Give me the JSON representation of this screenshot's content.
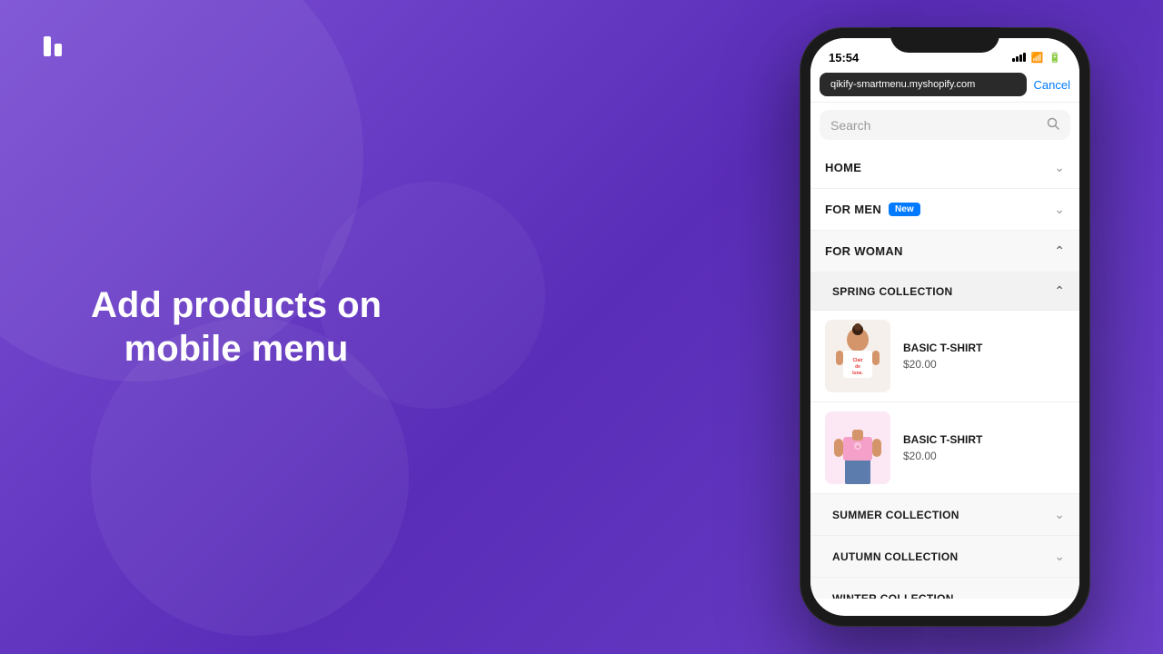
{
  "background": {
    "color": "#6b3fc7"
  },
  "logo": {
    "alt": "Qikify logo"
  },
  "hero": {
    "line1": "Add products on",
    "line2": "mobile menu"
  },
  "phone": {
    "status_bar": {
      "time": "15:54",
      "arrow": "▶"
    },
    "browser": {
      "url": "qikify-smartmenu.myshopify.com",
      "cancel_label": "Cancel"
    },
    "search": {
      "placeholder": "Search"
    },
    "menu_items": [
      {
        "label": "HOME",
        "badge": null,
        "expanded": false
      },
      {
        "label": "FOR MEN",
        "badge": "New",
        "expanded": false
      },
      {
        "label": "FOR WOMAN",
        "badge": null,
        "expanded": true,
        "sub_items": [
          {
            "label": "SPRING COLLECTION",
            "expanded": true,
            "products": [
              {
                "name": "BASIC T-SHIRT",
                "price": "$20.00",
                "img_id": "product1"
              },
              {
                "name": "BASIC T-SHIRT",
                "price": "$20.00",
                "img_id": "product2"
              }
            ]
          },
          {
            "label": "SUMMER COLLECTION",
            "expanded": false
          },
          {
            "label": "AUTUMN COLLECTION",
            "expanded": false
          },
          {
            "label": "WINTER COLLECTION",
            "expanded": false
          }
        ]
      }
    ]
  }
}
